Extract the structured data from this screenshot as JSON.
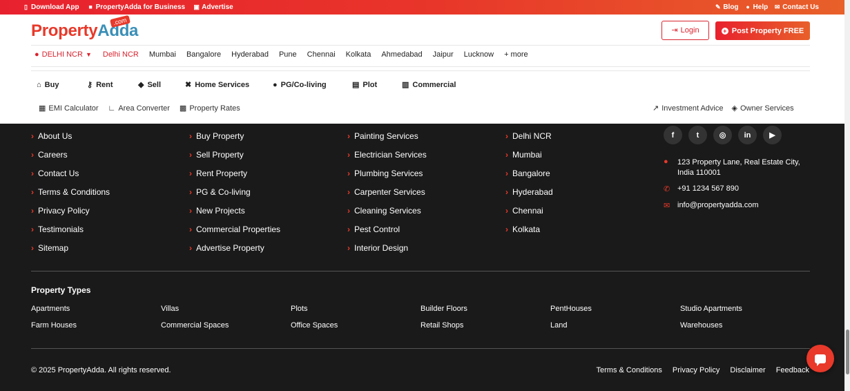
{
  "topbar": {
    "left": [
      {
        "icon": "mobile-icon",
        "label": "Download App"
      },
      {
        "icon": "briefcase-icon",
        "label": "PropertyAdda for Business"
      },
      {
        "icon": "ad-icon",
        "label": "Advertise"
      }
    ],
    "right": [
      {
        "icon": "blog-icon",
        "label": "Blog"
      },
      {
        "icon": "help-icon",
        "label": "Help"
      },
      {
        "icon": "envelope-icon",
        "label": "Contact Us"
      }
    ]
  },
  "header": {
    "logo_part1": "Property",
    "logo_part2": "Adda",
    "logo_badge": ".com",
    "login_label": "Login",
    "post_label": "Post Property FREE"
  },
  "cities": {
    "selected": "DELHI NCR",
    "items": [
      "Delhi NCR",
      "Mumbai",
      "Bangalore",
      "Hyderabad",
      "Pune",
      "Chennai",
      "Kolkata",
      "Ahmedabad",
      "Jaipur",
      "Lucknow",
      "+ more"
    ]
  },
  "mainnav": [
    {
      "icon": "home-icon",
      "label": "Buy"
    },
    {
      "icon": "key-icon",
      "label": "Rent"
    },
    {
      "icon": "tag-icon",
      "label": "Sell"
    },
    {
      "icon": "tools-icon",
      "label": "Home Services"
    },
    {
      "icon": "users-icon",
      "label": "PG/Co-living"
    },
    {
      "icon": "map-icon",
      "label": "Plot"
    },
    {
      "icon": "building-icon",
      "label": "Commercial"
    }
  ],
  "subnav_left": [
    {
      "icon": "calculator-icon",
      "label": "EMI Calculator"
    },
    {
      "icon": "ruler-icon",
      "label": "Area Converter"
    },
    {
      "icon": "map-marked-icon",
      "label": "Property Rates"
    }
  ],
  "subnav_right": [
    {
      "icon": "chart-line-icon",
      "label": "Investment Advice"
    },
    {
      "icon": "handshake-icon",
      "label": "Owner Services"
    }
  ],
  "footer": {
    "col1": [
      "About Us",
      "Careers",
      "Contact Us",
      "Terms & Conditions",
      "Privacy Policy",
      "Testimonials",
      "Sitemap"
    ],
    "col2": [
      "Buy Property",
      "Sell Property",
      "Rent Property",
      "PG & Co-living",
      "New Projects",
      "Commercial Properties",
      "Advertise Property"
    ],
    "col3": [
      "Painting Services",
      "Electrician Services",
      "Plumbing Services",
      "Carpenter Services",
      "Cleaning Services",
      "Pest Control",
      "Interior Design"
    ],
    "col4": [
      "Delhi NCR",
      "Mumbai",
      "Bangalore",
      "Hyderabad",
      "Chennai",
      "Kolkata"
    ],
    "social": [
      "facebook-icon",
      "twitter-icon",
      "instagram-icon",
      "linkedin-icon",
      "youtube-icon"
    ],
    "address_line1": "123 Property Lane, Real Estate City,",
    "address_line2": "India 110001",
    "phone": "+91 1234 567 890",
    "email": "info@propertyadda.com",
    "property_types_title": "Property Types",
    "property_types": [
      [
        "Apartments",
        "Villas",
        "Plots",
        "Builder Floors",
        "PentHouses",
        "Studio Apartments"
      ],
      [
        "Farm Houses",
        "Commercial Spaces",
        "Office Spaces",
        "Retail Shops",
        "Land",
        "Warehouses"
      ]
    ],
    "copyright": "© 2025 PropertyAdda. All rights reserved.",
    "bottom_links": [
      "Terms & Conditions",
      "Privacy Policy",
      "Disclaimer",
      "Feedback"
    ]
  },
  "colors": {
    "brand_red": "#e8392a",
    "brand_blue": "#3a8fb7",
    "footer_bg": "#1a1a1a"
  }
}
